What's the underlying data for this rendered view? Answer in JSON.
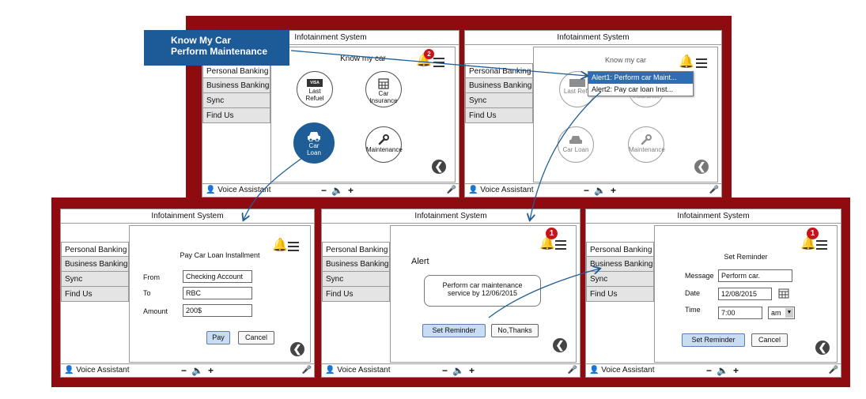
{
  "callout": {
    "line1": "Know My Car",
    "line2": "Perform Maintenance"
  },
  "app_title": "Infotainment System",
  "sidebar": [
    "Personal Banking",
    "Business Banking",
    "Sync",
    "Find Us"
  ],
  "footer": {
    "voice": "Voice Assistant",
    "vol_minus": "−",
    "vol_plus": "+"
  },
  "screen1": {
    "heading": "Know my car",
    "badge": "2",
    "tiles": {
      "last_refuel": {
        "badge": "VISA",
        "line1": "Last",
        "line2": "Refuel"
      },
      "car_insurance": {
        "line1": "Car",
        "line2": "Insurance"
      },
      "car_loan": {
        "line1": "Car",
        "line2": "Loan"
      },
      "maintenance": {
        "label": "Maintenance"
      }
    }
  },
  "screen2": {
    "heading": "Know my car",
    "alerts": [
      "Alert1: Perform car Maint...",
      "Alert2: Pay car loan Inst..."
    ],
    "tiles": {
      "last_refuel": "Last Refu",
      "car_insurance": "Insurance",
      "car_loan": "Car Loan",
      "maintenance": "Maintenance"
    }
  },
  "screen3": {
    "heading": "Pay Car Loan Installment",
    "from_label": "From",
    "from_value": "Checking Account",
    "to_label": "To",
    "to_value": "RBC",
    "amount_label": "Amount",
    "amount_value": "200$",
    "pay": "Pay",
    "cancel": "Cancel"
  },
  "screen4": {
    "badge": "1",
    "heading": "Alert",
    "message_line1": "Perform car maintenance",
    "message_line2": "service by 12/06/2015",
    "set_reminder": "Set Reminder",
    "no_thanks": "No,Thanks"
  },
  "screen5": {
    "badge": "1",
    "heading": "Set Reminder",
    "message_label": "Message",
    "message_value": "Perform car.",
    "date_label": "Date",
    "date_value": "12/08/2015",
    "time_label": "Time",
    "time_value": "7:00",
    "ampm": "am",
    "set_reminder": "Set Reminder",
    "cancel": "Cancel"
  }
}
